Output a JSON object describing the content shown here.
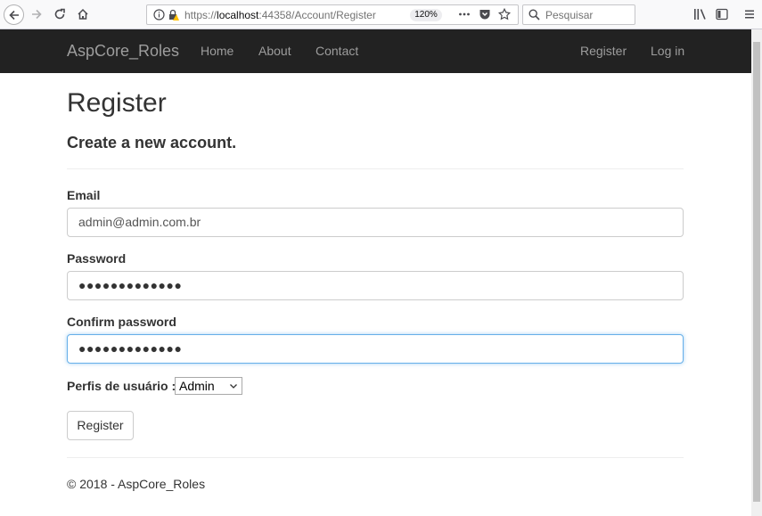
{
  "browser": {
    "url_prefix": "https://",
    "url_host": "localhost",
    "url_rest": ":44358/Account/Register",
    "zoom": "120%",
    "search_placeholder": "Pesquisar"
  },
  "navbar": {
    "brand": "AspCore_Roles",
    "links": [
      "Home",
      "About",
      "Contact"
    ],
    "right_links": [
      "Register",
      "Log in"
    ]
  },
  "page": {
    "title": "Register",
    "subtitle": "Create a new account."
  },
  "form": {
    "email_label": "Email",
    "email_value": "admin@admin.com.br",
    "password_label": "Password",
    "password_value": "●●●●●●●●●●●●●",
    "confirm_label": "Confirm password",
    "confirm_value": "●●●●●●●●●●●●●",
    "role_label": "Perfis de usuário :",
    "role_selected": "Admin",
    "submit_label": "Register"
  },
  "footer": {
    "text": "© 2018 - AspCore_Roles"
  },
  "colors": {
    "navbar_bg": "#222222",
    "nav_link": "#9d9d9d",
    "focus_border": "#66afe9"
  }
}
